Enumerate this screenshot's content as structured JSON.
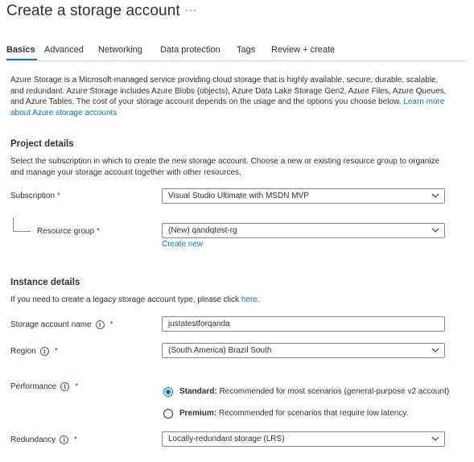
{
  "page": {
    "title": "Create a storage account",
    "more_label": "···"
  },
  "tabs": [
    {
      "label": "Basics",
      "active": true
    },
    {
      "label": "Advanced",
      "active": false
    },
    {
      "label": "Networking",
      "active": false
    },
    {
      "label": "Data protection",
      "active": false
    },
    {
      "label": "Tags",
      "active": false
    },
    {
      "label": "Review + create",
      "active": false
    }
  ],
  "intro": {
    "text": "Azure Storage is a Microsoft-managed service providing cloud storage that is highly available, secure, durable, scalable, and redundant. Azure Storage includes Azure Blobs (objects), Azure Data Lake Storage Gen2, Azure Files, Azure Queues, and Azure Tables. The cost of your storage account depends on the usage and the options you choose below. ",
    "link": "Learn more about Azure storage accounts"
  },
  "project_details": {
    "title": "Project details",
    "description": "Select the subscription in which to create the new storage account. Choose a new or existing resource group to organize and manage your storage account together with other resources.",
    "subscription": {
      "label": "Subscription",
      "required_mark": "*",
      "value": "Visual Studio Ultimate with MSDN MVP"
    },
    "resource_group": {
      "label": "Resource group",
      "required_mark": "*",
      "value": "(New) qandqtest-rg",
      "create_new": "Create new"
    }
  },
  "instance_details": {
    "title": "Instance details",
    "description_prefix": "If you need to create a legacy storage account type, please click ",
    "description_link": "here",
    "description_suffix": ".",
    "storage_account_name": {
      "label": "Storage account name",
      "required_mark": "*",
      "value": "justatestforqanda"
    },
    "region": {
      "label": "Region",
      "required_mark": "*",
      "value": "(South America) Brazil South"
    },
    "performance": {
      "label": "Performance",
      "required_mark": "*",
      "options": [
        {
          "name": "Standard:",
          "description": "Recommended for most scenarios (general-purpose v2 account)",
          "selected": true
        },
        {
          "name": "Premium:",
          "description": "Recommended for scenarios that require low latency.",
          "selected": false
        }
      ]
    },
    "redundancy": {
      "label": "Redundancy",
      "required_mark": "*",
      "value": "Locally-redundant storage (LRS)"
    }
  },
  "colors": {
    "accent": "#0078d4",
    "required": "#a4262c",
    "text": "#323130",
    "border": "#8a8886"
  },
  "icons": [
    "more-icon",
    "info-icon",
    "chevron-down-icon",
    "radio-icon"
  ]
}
